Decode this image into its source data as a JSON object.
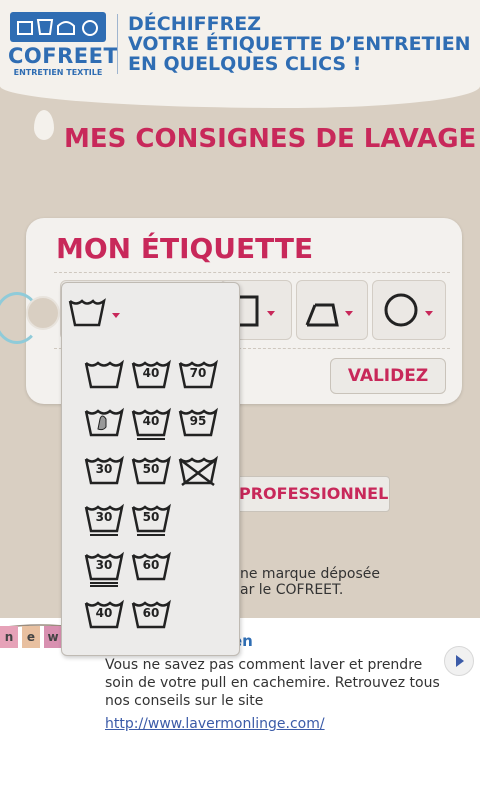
{
  "header": {
    "brand": "COFREET",
    "brand_sub": "ENTRETIEN TEXTILE",
    "tagline_lines": [
      "DÉCHIFFREZ",
      "VOTRE ÉTIQUETTE D’ENTRETIEN",
      "EN QUELQUES CLICS !"
    ]
  },
  "main": {
    "section_title": "MES CONSIGNES DE LAVAGE",
    "tag_title": "MON ÉTIQUETTE",
    "validate_label": "VALIDEZ",
    "pro_button_label": "PROFESSIONNEL",
    "trademark_lines": [
      "ne marque déposée",
      "ar le COFREET."
    ]
  },
  "dropdown": {
    "rows": [
      [
        "",
        "40",
        "70"
      ],
      [
        "hand",
        "40",
        "95"
      ],
      [
        "30",
        "50",
        "x"
      ],
      [
        "30",
        "50"
      ],
      [
        "30",
        "60"
      ],
      [
        "40",
        "60"
      ]
    ]
  },
  "news": {
    "title_fragment": "en",
    "text": "Vous ne savez pas comment laver et prendre soin de votre pull en cachemire. Retrouvez tous nos conseils sur le site",
    "link": "http://www.lavermonlinge.com/",
    "flags": [
      "n",
      "e",
      "w"
    ]
  },
  "colors": {
    "brand_blue": "#2f6db3",
    "accent_pink": "#c8285a",
    "background": "#d9cfc2"
  }
}
